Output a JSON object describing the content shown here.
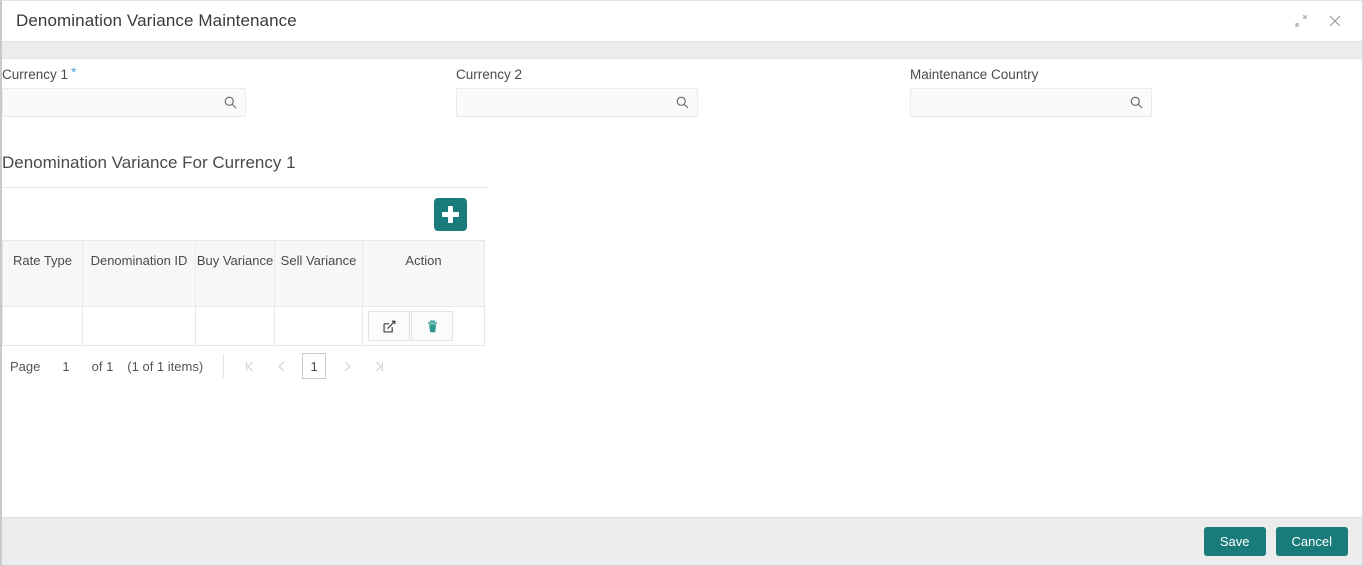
{
  "window": {
    "title": "Denomination Variance Maintenance",
    "controls": [
      {
        "name": "minimize-icon",
        "label": "Minimize"
      },
      {
        "name": "close-icon",
        "label": "Close"
      }
    ]
  },
  "form": {
    "fields": [
      {
        "label": "Currency 1",
        "required": true,
        "required_marker": "*",
        "value": "",
        "placeholder": "",
        "icon": "search-icon"
      },
      {
        "label": "Currency 2",
        "required": false,
        "required_marker": "",
        "value": "",
        "placeholder": "",
        "icon": "search-icon"
      },
      {
        "label": "Maintenance Country",
        "required": false,
        "required_marker": "",
        "value": "",
        "placeholder": "",
        "icon": "search-icon"
      }
    ]
  },
  "section": {
    "title": "Denomination Variance For Currency 1",
    "add_button": {
      "label": "+",
      "icon": "plus-icon",
      "color": "#1a7b7b"
    }
  },
  "grid": {
    "columns": [
      "Rate Type",
      "Denomination ID",
      "Buy Variance",
      "Sell Variance",
      "Action"
    ],
    "rows": [
      {
        "rate_type": "",
        "denomination_id": "",
        "buy_variance": "",
        "sell_variance": "",
        "actions": [
          {
            "name": "edit-row-button",
            "icon": "edit-icon",
            "color": "#3d3d3d"
          },
          {
            "name": "delete-row-button",
            "icon": "trash-icon",
            "color": "#2f9b8e"
          }
        ]
      }
    ]
  },
  "pagination": {
    "page_label": "Page",
    "current_page": "1",
    "of_label": "of 1",
    "items_label": "(1 of 1 items)",
    "first_icon": "first-page-icon",
    "prev_icon": "prev-page-icon",
    "next_icon": "next-page-icon",
    "last_icon": "last-page-icon",
    "pages": [
      "1"
    ]
  },
  "footer": {
    "save_label": "Save",
    "cancel_label": "Cancel"
  },
  "theme": {
    "accent": "#1a7b7b",
    "required_star": "#4ba3dd",
    "header_bg": "#f7f7f7",
    "footer_bg": "#ececec"
  }
}
